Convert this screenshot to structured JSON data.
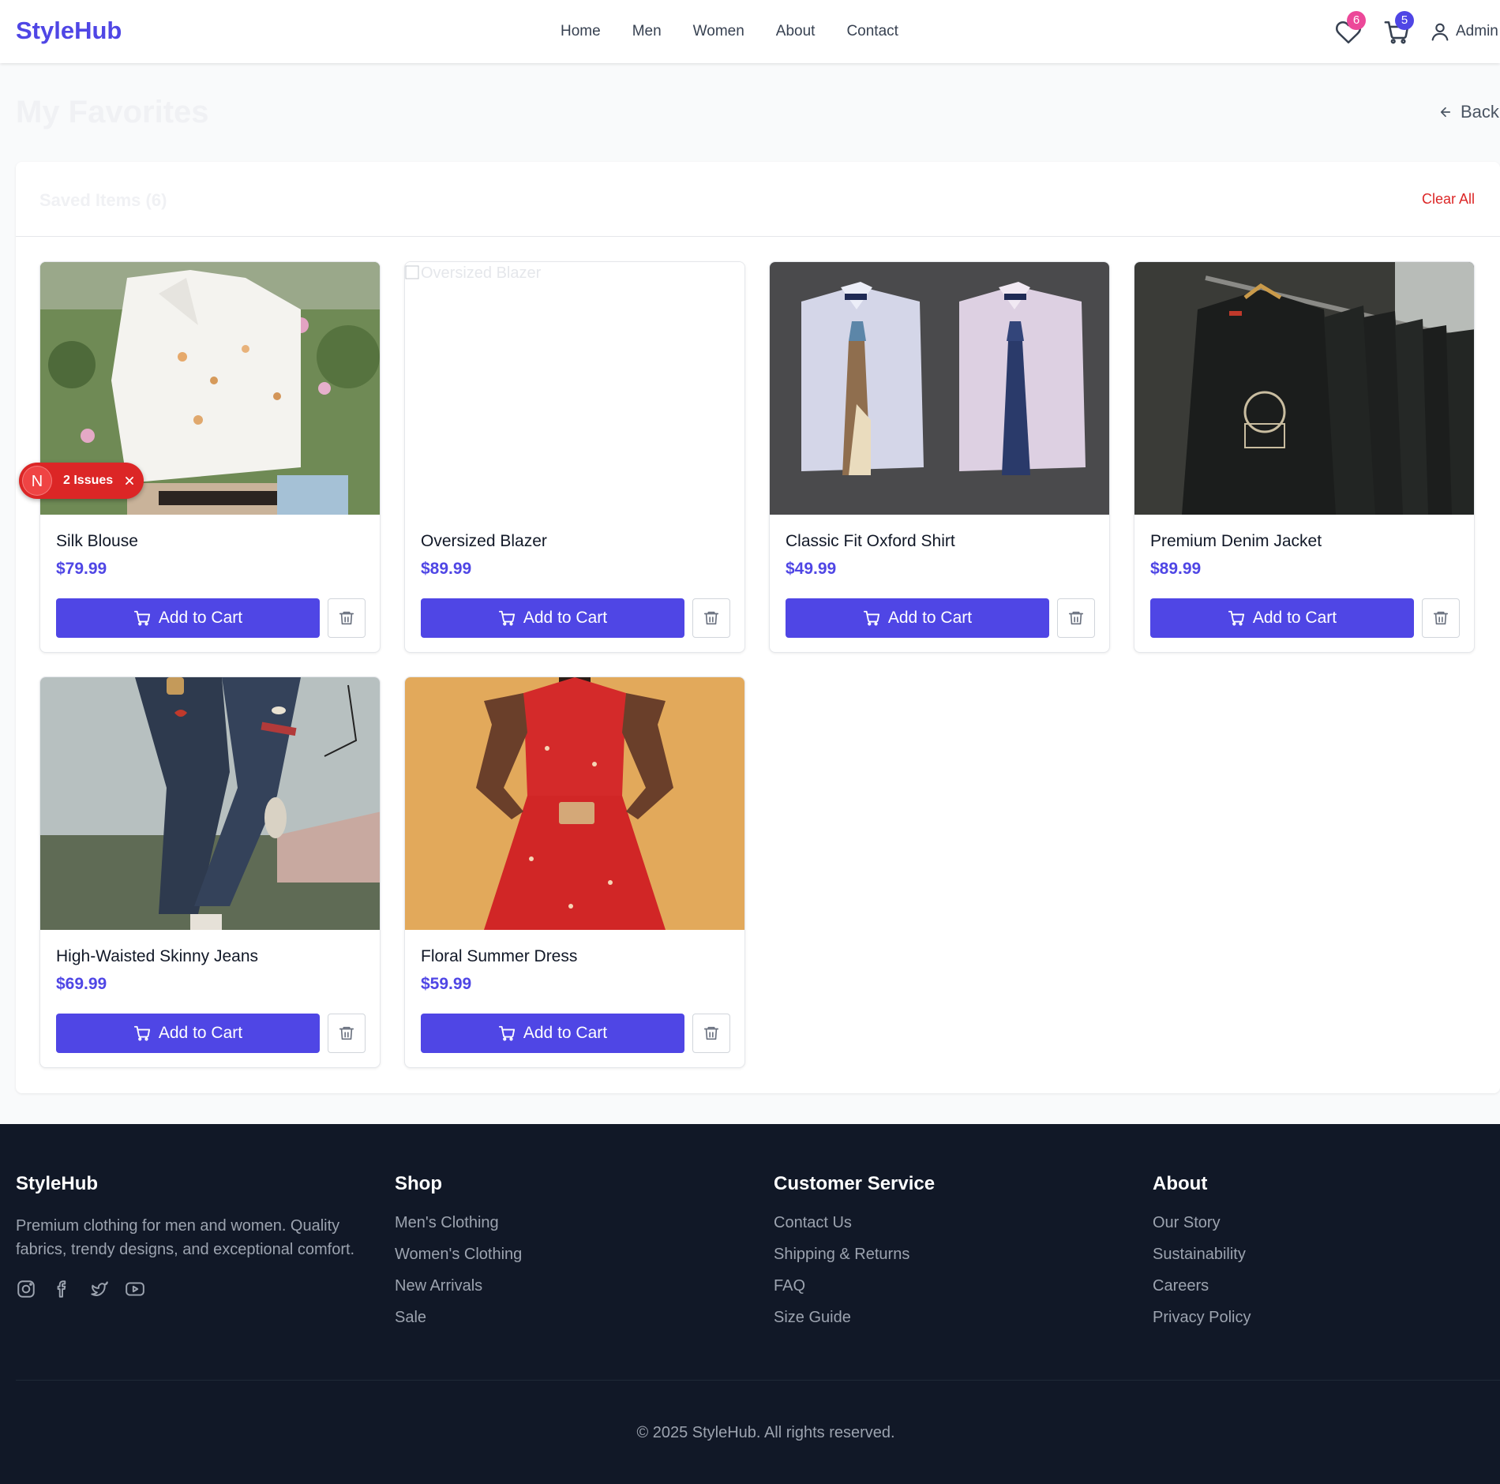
{
  "header": {
    "logo": "StyleHub",
    "nav": [
      "Home",
      "Men",
      "Women",
      "About",
      "Contact"
    ],
    "favorites_count": "6",
    "cart_count": "5",
    "user_label": "Admin",
    "favorites_badge_color": "#ec4899",
    "cart_badge_color": "#4f46e5"
  },
  "page": {
    "title": "My Favorites",
    "back_label": "Back"
  },
  "favorites": {
    "saved_label": "Saved Items (6)",
    "clear_all_label": "Clear All",
    "add_to_cart_label": "Add to Cart",
    "items": [
      {
        "name": "Silk Blouse",
        "price": "$79.99",
        "image": "photo"
      },
      {
        "name": "Oversized Blazer",
        "price": "$89.99",
        "image": "broken",
        "alt": "Oversized Blazer"
      },
      {
        "name": "Classic Fit Oxford Shirt",
        "price": "$49.99",
        "image": "photo"
      },
      {
        "name": "Premium Denim Jacket",
        "price": "$89.99",
        "image": "photo"
      },
      {
        "name": "High-Waisted Skinny Jeans",
        "price": "$69.99",
        "image": "photo"
      },
      {
        "name": "Floral Summer Dress",
        "price": "$59.99",
        "image": "photo"
      }
    ]
  },
  "dev_overlay": {
    "letter": "N",
    "issues_label": "2 Issues"
  },
  "footer": {
    "brand": "StyleHub",
    "description": "Premium clothing for men and women. Quality fabrics, trendy designs, and exceptional comfort.",
    "social_icons": [
      "instagram-icon",
      "facebook-icon",
      "twitter-icon",
      "youtube-icon"
    ],
    "columns": [
      {
        "title": "Shop",
        "links": [
          "Men's Clothing",
          "Women's Clothing",
          "New Arrivals",
          "Sale"
        ]
      },
      {
        "title": "Customer Service",
        "links": [
          "Contact Us",
          "Shipping & Returns",
          "FAQ",
          "Size Guide"
        ]
      },
      {
        "title": "About",
        "links": [
          "Our Story",
          "Sustainability",
          "Careers",
          "Privacy Policy"
        ]
      }
    ],
    "copyright": "© 2025 StyleHub. All rights reserved."
  },
  "colors": {
    "accent": "#4f46e5",
    "danger": "#dc2626",
    "footer_bg": "#111827"
  }
}
